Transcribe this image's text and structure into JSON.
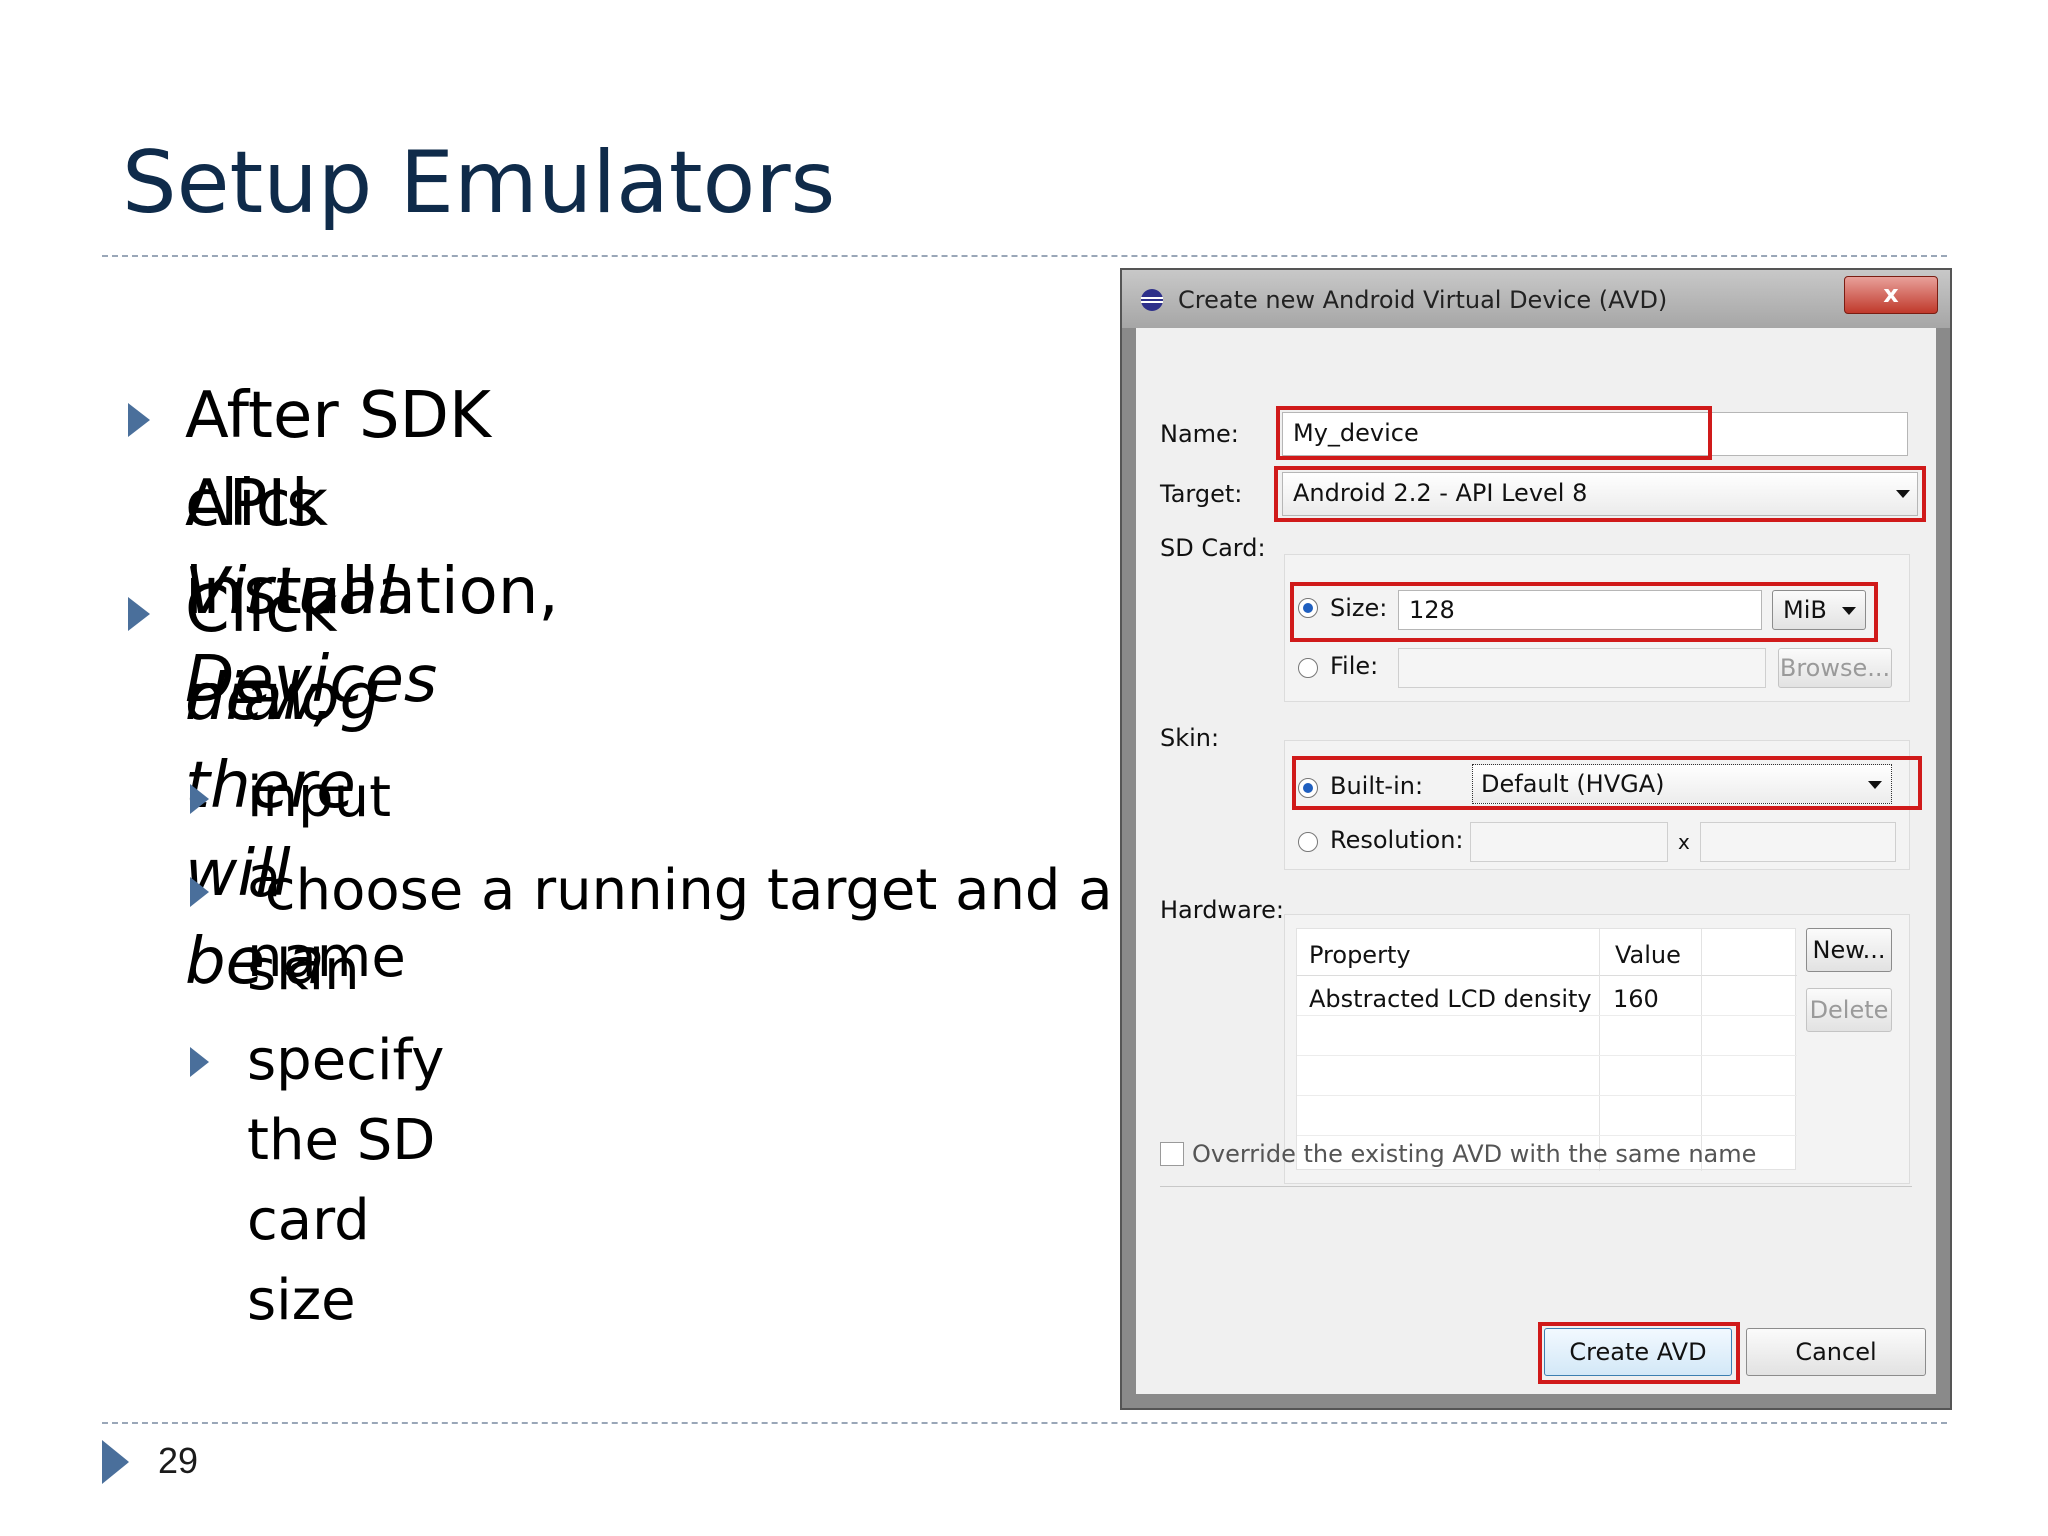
{
  "slide": {
    "title": "Setup Emulators",
    "page_number": "29"
  },
  "bullets": [
    {
      "line1": "After SDK APIs installation,",
      "line2_prefix": "click ",
      "line2_italic": "Virtual Devices"
    },
    {
      "line1_prefix": "Click ",
      "line1_italic": "new, there will be a",
      "line2_italic": "dialog"
    }
  ],
  "sub_bullets": [
    {
      "text": "input a name"
    },
    {
      "line1": " choose a running target and a",
      "line2": "skin"
    },
    {
      "text": "specify the SD card size"
    }
  ],
  "dialog": {
    "title": "Create new Android Virtual Device (AVD)",
    "close_label": "x",
    "name_label": "Name:",
    "name_value": "My_device",
    "target_label": "Target:",
    "target_value": "Android 2.2 - API Level 8",
    "sdcard_label": "SD Card:",
    "size_label": "Size:",
    "size_value": "128",
    "size_unit": "MiB",
    "file_label": "File:",
    "file_value": "",
    "browse_label": "Browse...",
    "skin_label": "Skin:",
    "builtin_label": "Built-in:",
    "builtin_value": "Default (HVGA)",
    "resolution_label": "Resolution:",
    "resolution_x": "x",
    "hardware_label": "Hardware:",
    "table_headers": {
      "property": "Property",
      "value": "Value"
    },
    "table_rows": [
      {
        "property": "Abstracted LCD density",
        "value": "160"
      }
    ],
    "new_label": "New...",
    "delete_label": "Delete",
    "override_label": "Override the existing AVD with the same name",
    "create_label": "Create AVD",
    "cancel_label": "Cancel"
  },
  "colors": {
    "title": "#0f2b4a",
    "bullet_marker": "#4a6f9b",
    "highlight": "#d01a1a"
  }
}
